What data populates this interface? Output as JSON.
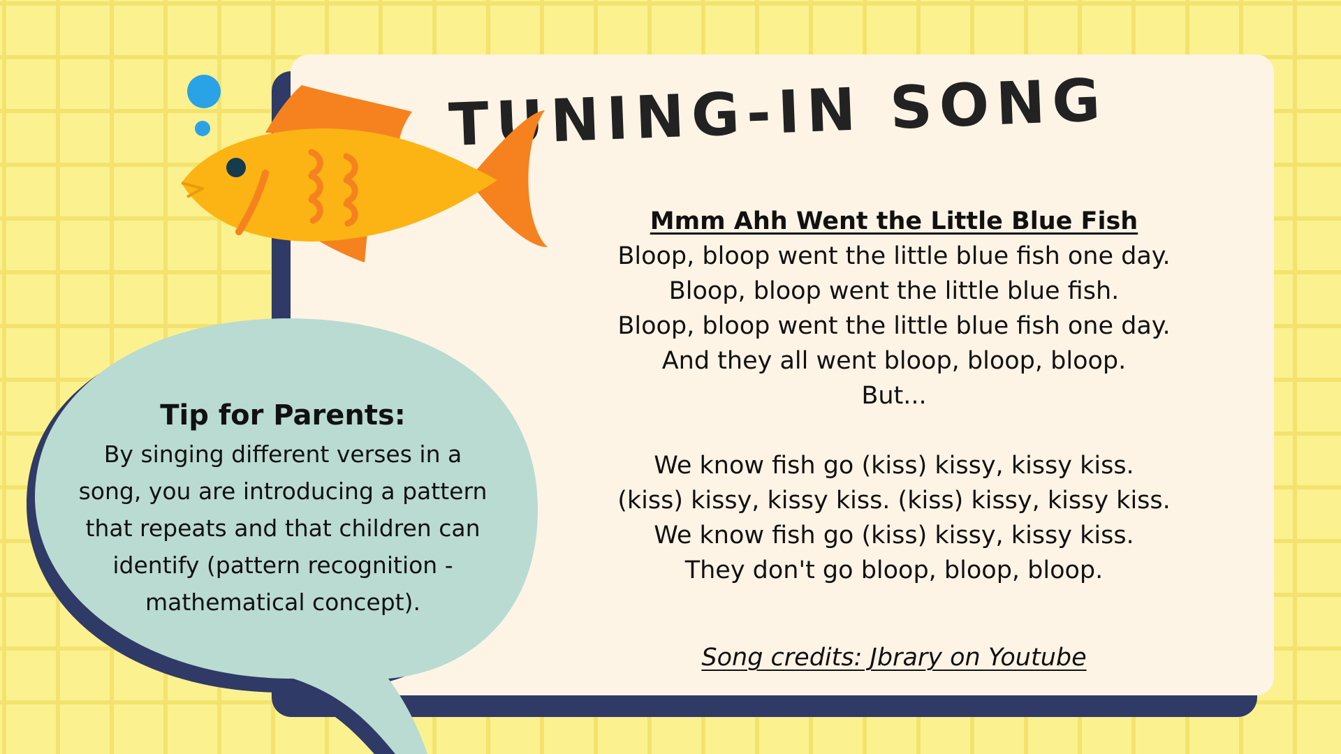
{
  "title": "TUNING-IN SONG",
  "song": {
    "title": "Mmm Ahh Went the Little Blue Fish",
    "verse1": [
      "Bloop, bloop went the little blue fish one day.",
      "Bloop, bloop went the little blue fish.",
      "Bloop, bloop went the little blue fish one day.",
      "And they all went bloop, bloop, bloop.",
      "But..."
    ],
    "verse2": [
      "We know fish go (kiss) kissy, kissy kiss.",
      "(kiss) kissy, kissy kiss. (kiss) kissy, kissy kiss.",
      "We know fish go (kiss) kissy, kissy kiss.",
      "They don't go bloop, bloop, bloop."
    ],
    "credits": "Song credits: Jbrary on Youtube"
  },
  "tip": {
    "title": "Tip for Parents:",
    "text": "By singing different verses in a song, you are introducing a pattern that repeats and that children can identify (pattern recognition - mathematical concept)."
  },
  "colors": {
    "background": "#fbf18f",
    "grid": "#f3e36e",
    "card": "#fdf4e6",
    "card_shadow": "#2f3a66",
    "bubble": "#badbd1",
    "fish_body": "#fbb413",
    "fish_fin": "#f5821f",
    "bubbles": "#29a3e6"
  },
  "icons": {
    "fish": "goldfish-illustration",
    "bubbles": "water-bubbles"
  }
}
